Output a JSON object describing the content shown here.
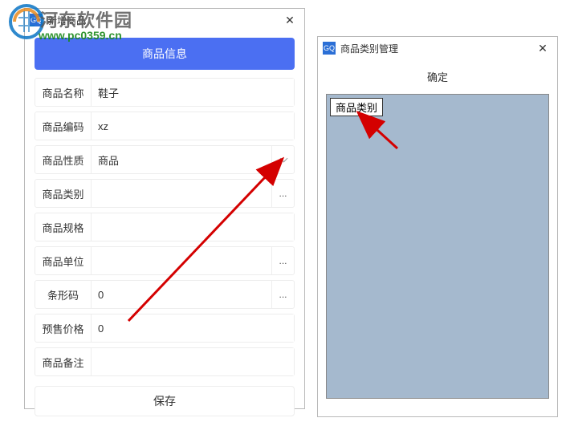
{
  "window1": {
    "app_icon": "GQ",
    "title": "新增商品",
    "tab_label": "商品信息",
    "fields": {
      "name_label": "商品名称",
      "name_value": "鞋子",
      "code_label": "商品编码",
      "code_value": "xz",
      "nature_label": "商品性质",
      "nature_value": "商品",
      "category_label": "商品类别",
      "category_value": "",
      "spec_label": "商品规格",
      "spec_value": "",
      "unit_label": "商品单位",
      "unit_value": "",
      "barcode_label": "条形码",
      "barcode_value": "0",
      "price_label": "预售价格",
      "price_value": "0",
      "remark_label": "商品备注",
      "remark_value": ""
    },
    "more_btn": "...",
    "save_label": "保存"
  },
  "window2": {
    "app_icon": "GQ",
    "title": "商品类别管理",
    "confirm_label": "确定",
    "category_root": "商品类别"
  },
  "watermark": {
    "site_name": "河东软件园",
    "site_url": "www.pc0359.cn"
  }
}
